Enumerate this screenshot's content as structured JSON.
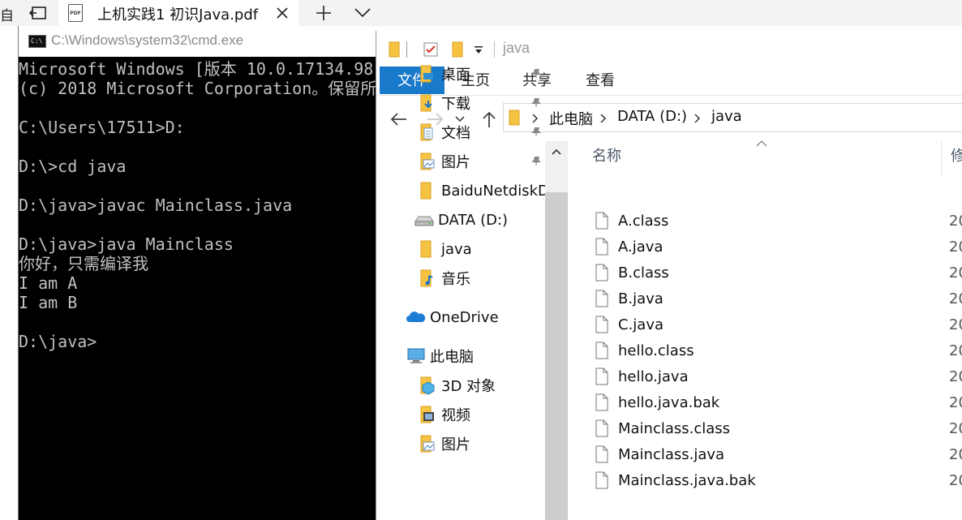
{
  "browser": {
    "tab_title": "上机实践1 初识Java.pdf",
    "pdf_label": "PDF",
    "edge_glyph": "自"
  },
  "cmd": {
    "title": "C:\\Windows\\system32\\cmd.exe",
    "lines": [
      "Microsoft Windows [版本 10.0.17134.98",
      "(c) 2018 Microsoft Corporation。保留所",
      "",
      "C:\\Users\\17511>D:",
      "",
      "D:\\>cd java",
      "",
      "D:\\java>javac Mainclass.java",
      "",
      "D:\\java>java Mainclass",
      "你好，只需编译我",
      "I am A",
      "I am B",
      "",
      "D:\\java>"
    ]
  },
  "explorer": {
    "window_title": "java",
    "ribbon_tabs": [
      "文件",
      "主页",
      "共享",
      "查看"
    ],
    "breadcrumb": [
      "此电脑",
      "DATA (D:)",
      "java"
    ],
    "nav_items": [
      {
        "label": "桌面",
        "icon": "desktop-folder-icon",
        "pinned": true
      },
      {
        "label": "下载",
        "icon": "downloads-folder-icon",
        "pinned": true
      },
      {
        "label": "文档",
        "icon": "documents-folder-icon",
        "pinned": true
      },
      {
        "label": "图片",
        "icon": "pictures-folder-icon",
        "pinned": true
      },
      {
        "label": "BaiduNetdiskD",
        "icon": "folder-icon",
        "pinned": false
      },
      {
        "label": "DATA (D:)",
        "icon": "drive-icon",
        "pinned": false
      },
      {
        "label": "java",
        "icon": "folder-icon",
        "pinned": false
      },
      {
        "label": "音乐",
        "icon": "music-folder-icon",
        "pinned": false
      },
      {
        "label": "OneDrive",
        "icon": "onedrive-icon",
        "pinned": false
      },
      {
        "label": "此电脑",
        "icon": "computer-icon",
        "pinned": false
      },
      {
        "label": "3D 对象",
        "icon": "3d-objects-icon",
        "pinned": false
      },
      {
        "label": "视频",
        "icon": "videos-folder-icon",
        "pinned": false
      },
      {
        "label": "图片",
        "icon": "pictures-folder-icon",
        "pinned": false
      }
    ],
    "columns": {
      "name": "名称",
      "date": "修"
    },
    "files": [
      {
        "name": "A.class",
        "date": "20"
      },
      {
        "name": "A.java",
        "date": "20"
      },
      {
        "name": "B.class",
        "date": "20"
      },
      {
        "name": "B.java",
        "date": "20"
      },
      {
        "name": "C.java",
        "date": "20"
      },
      {
        "name": "hello.class",
        "date": "20"
      },
      {
        "name": "hello.java",
        "date": "20"
      },
      {
        "name": "hello.java.bak",
        "date": "20"
      },
      {
        "name": "Mainclass.class",
        "date": "20"
      },
      {
        "name": "Mainclass.java",
        "date": "20"
      },
      {
        "name": "Mainclass.java.bak",
        "date": "20"
      }
    ],
    "colors": {
      "accent": "#1979ca",
      "folder": "#f5c242"
    }
  }
}
